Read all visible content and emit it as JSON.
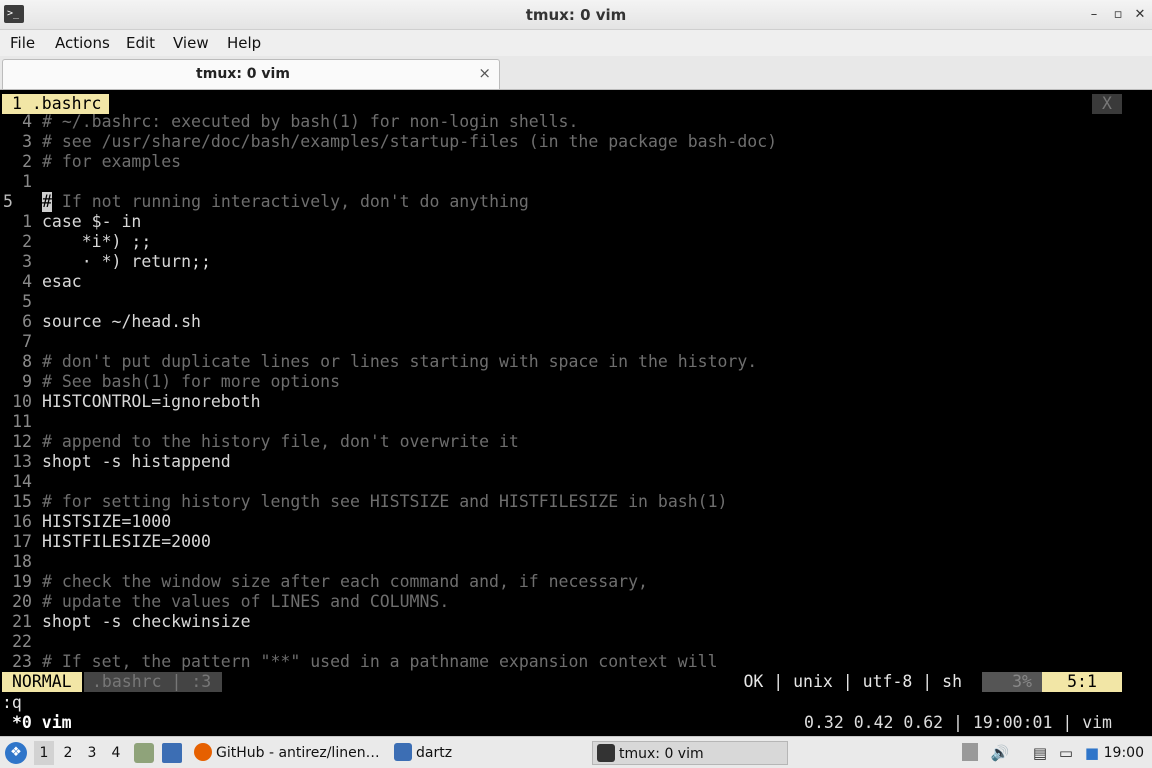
{
  "window": {
    "title": "tmux: 0 vim",
    "minimize": "–",
    "restore": "▫",
    "maximize": "□",
    "close": "✕"
  },
  "menu": [
    "File",
    "Actions",
    "Edit",
    "View",
    "Help"
  ],
  "tab": {
    "label": "tmux: 0 vim",
    "close": "×"
  },
  "vim": {
    "buffer": "1 .bashrc",
    "buffer_close": "X",
    "cursor_line_number": "5",
    "cursor_char": "#",
    "lines": [
      {
        "n": "4",
        "t": "# ~/.bashrc: executed by bash(1) for non-login shells.",
        "c": true
      },
      {
        "n": "3",
        "t": "# see /usr/share/doc/bash/examples/startup-files (in the package bash-doc)",
        "c": true
      },
      {
        "n": "2",
        "t": "# for examples",
        "c": true
      },
      {
        "n": "1",
        "t": "",
        "c": false
      },
      {
        "n": "5",
        "t": " If not running interactively, don't do anything",
        "c": true,
        "cur": true
      },
      {
        "n": "1",
        "t": "case $- in",
        "c": false
      },
      {
        "n": "2",
        "t": "    *i*) ;;",
        "c": false
      },
      {
        "n": "3",
        "t": "    · *) return;;",
        "c": false
      },
      {
        "n": "4",
        "t": "esac",
        "c": false
      },
      {
        "n": "5",
        "t": "",
        "c": false
      },
      {
        "n": "6",
        "t": "source ~/head.sh",
        "c": false
      },
      {
        "n": "7",
        "t": "",
        "c": false
      },
      {
        "n": "8",
        "t": "# don't put duplicate lines or lines starting with space in the history.",
        "c": true
      },
      {
        "n": "9",
        "t": "# See bash(1) for more options",
        "c": true
      },
      {
        "n": "10",
        "t": "HISTCONTROL=ignoreboth",
        "c": false
      },
      {
        "n": "11",
        "t": "",
        "c": false
      },
      {
        "n": "12",
        "t": "# append to the history file, don't overwrite it",
        "c": true
      },
      {
        "n": "13",
        "t": "shopt -s histappend",
        "c": false
      },
      {
        "n": "14",
        "t": "",
        "c": false
      },
      {
        "n": "15",
        "t": "# for setting history length see HISTSIZE and HISTFILESIZE in bash(1)",
        "c": true
      },
      {
        "n": "16",
        "t": "HISTSIZE=1000",
        "c": false
      },
      {
        "n": "17",
        "t": "HISTFILESIZE=2000",
        "c": false
      },
      {
        "n": "18",
        "t": "",
        "c": false
      },
      {
        "n": "19",
        "t": "# check the window size after each command and, if necessary,",
        "c": true
      },
      {
        "n": "20",
        "t": "# update the values of LINES and COLUMNS.",
        "c": true
      },
      {
        "n": "21",
        "t": "shopt -s checkwinsize",
        "c": false
      },
      {
        "n": "22",
        "t": "",
        "c": false
      },
      {
        "n": "23",
        "t": "# If set, the pattern \"**\" used in a pathname expansion context will",
        "c": true
      }
    ],
    "status": {
      "mode": "NORMAL",
      "file": ".bashrc | :3",
      "right": "OK | unix | utf-8 | sh",
      "percent": "3%",
      "position": "5:1"
    },
    "cmdline": ":q"
  },
  "tmux": {
    "window": "*0 vim",
    "right": "0.32 0.42 0.62 | 19:00:01 | vim"
  },
  "taskbar": {
    "workspaces": [
      "1",
      "2",
      "3",
      "4"
    ],
    "tasks": [
      {
        "label": "GitHub - antirez/linen…",
        "icon": "firefox-icon"
      },
      {
        "label": "dartz",
        "icon": "folder-icon"
      },
      {
        "label": "tmux: 0 vim",
        "icon": "terminal-icon"
      }
    ],
    "clock": "19:00",
    "colors": {
      "accent": "#2f75c9",
      "firefox": "#e66000",
      "folder": "#3c6eb4"
    }
  }
}
